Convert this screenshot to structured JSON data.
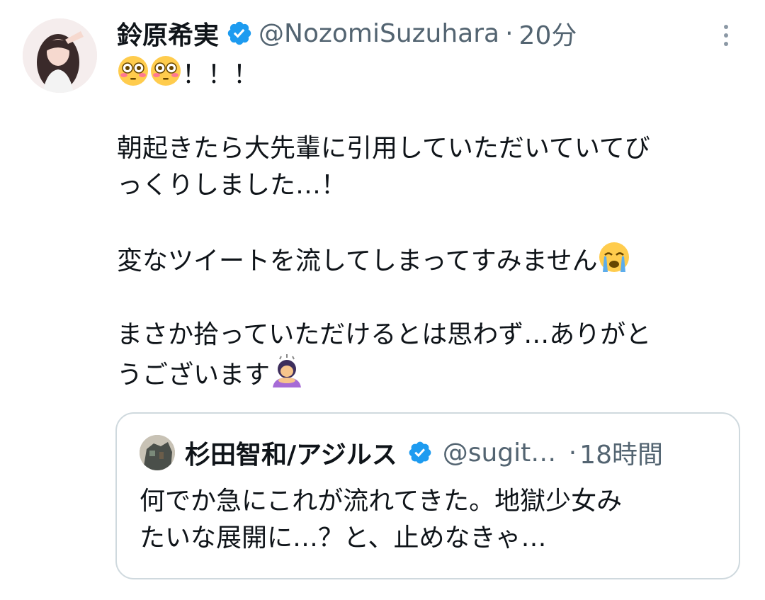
{
  "tweet": {
    "author_name": "鈴原希実",
    "handle": "@NozomiSuzuhara",
    "separator": "·",
    "time": "20分",
    "lines": {
      "l1": "！！！",
      "l2a": "朝起きたら大先輩に引用していただいていてび",
      "l2b": "っくりしました…！",
      "l3": "変なツイートを流してしまってすみません",
      "l4a": "まさか拾っていただけるとは思わず…ありがと",
      "l4b": "うございます"
    }
  },
  "quoted": {
    "author_name": "杉田智和/アジルス",
    "handle": "@sugit…",
    "separator": "·",
    "time": "18時間",
    "line1": "何でか急にこれが流れてきた。地獄少女み",
    "line2": "たいな展開に…？と、止めなきゃ…"
  },
  "icons": [
    "avatar",
    "verified-badge-icon",
    "more-options-icon",
    "flushed-face-emoji",
    "crying-face-emoji",
    "person-bowing-emoji"
  ],
  "colors": {
    "verified": "#1d9bf0",
    "secondary_text": "#536471",
    "border": "#cfd9de"
  }
}
